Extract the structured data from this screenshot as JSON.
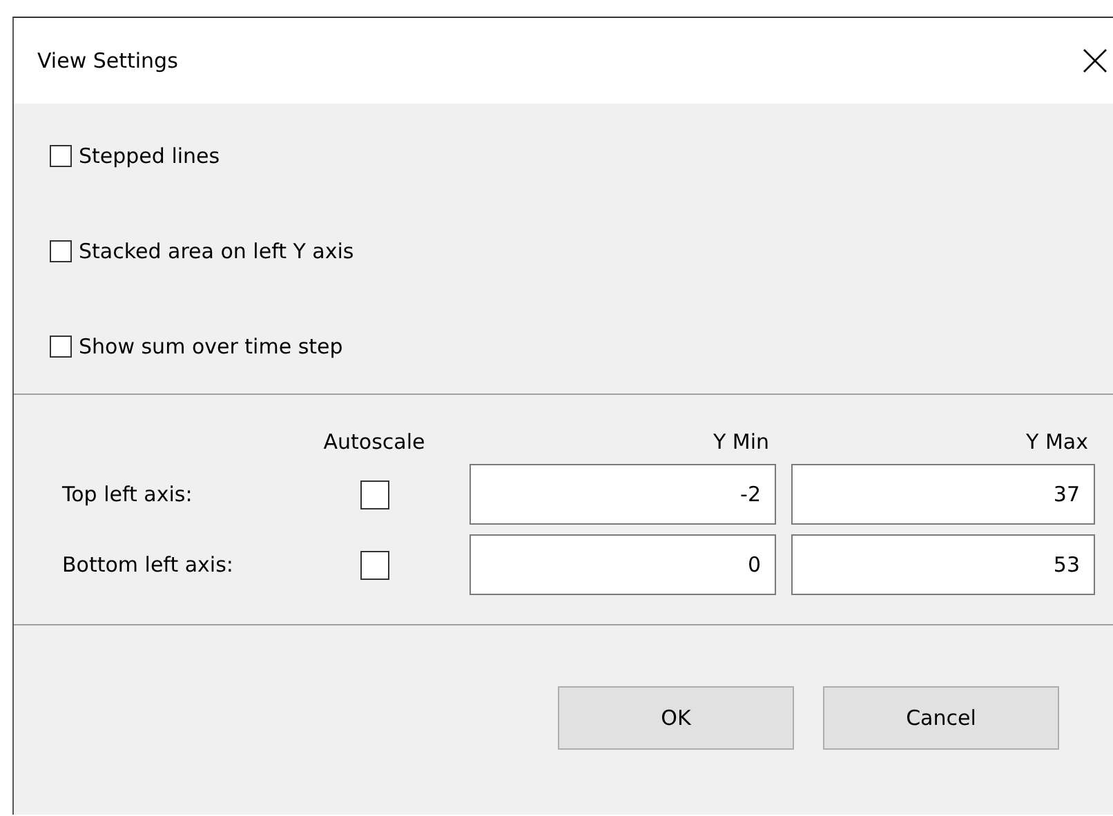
{
  "window": {
    "title": "View Settings"
  },
  "options": [
    {
      "label": "Stepped lines",
      "checked": false
    },
    {
      "label": "Stacked area on left Y axis",
      "checked": false
    },
    {
      "label": "Show sum over time step",
      "checked": false
    }
  ],
  "axes": {
    "columns": [
      "Autoscale",
      "Y Min",
      "Y Max"
    ],
    "rows": [
      {
        "label": "Top left axis:",
        "autoscale": false,
        "y_min": "-2",
        "y_max": "37"
      },
      {
        "label": "Bottom left axis:",
        "autoscale": false,
        "y_min": "0",
        "y_max": "53"
      }
    ]
  },
  "buttons": [
    "OK",
    "Cancel"
  ]
}
